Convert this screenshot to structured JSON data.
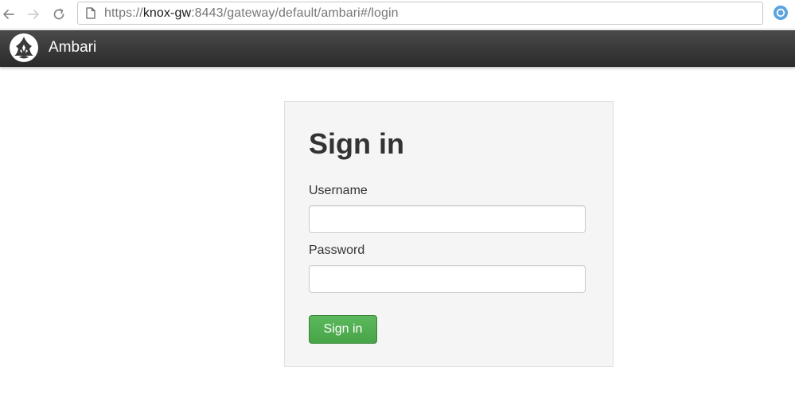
{
  "browser": {
    "url_prefix": "https://",
    "url_host": "knox-gw",
    "url_rest": ":8443/gateway/default/ambari#/login",
    "icons": {
      "back": "arrow-left-icon",
      "forward": "arrow-right-icon",
      "reload": "reload-icon",
      "page": "page-icon",
      "extension": "extension-icon"
    }
  },
  "navbar": {
    "brand_name": "Ambari",
    "logo_icon": "ambari-logo-icon"
  },
  "login": {
    "title": "Sign in",
    "username_label": "Username",
    "username_value": "",
    "password_label": "Password",
    "password_value": "",
    "submit_label": "Sign in"
  },
  "colors": {
    "navbar_bg": "#3a3a3a",
    "card_bg": "#f5f5f5",
    "button_green": "#5cb85c",
    "text_dark": "#333333"
  }
}
